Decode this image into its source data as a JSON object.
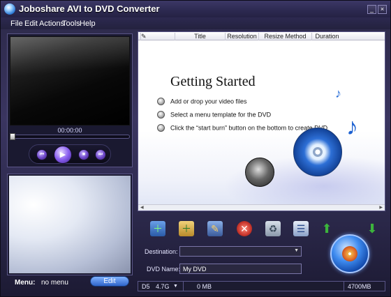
{
  "window": {
    "title": "Joboshare AVI to DVD Converter",
    "minimize_glyph": "_",
    "close_glyph": "×"
  },
  "menubar": {
    "items": [
      "File",
      "Edit",
      "Actions",
      "Tools",
      "Help"
    ]
  },
  "preview": {
    "time": "00:00:00",
    "seek_position": 0,
    "controls": {
      "prev": "⏮",
      "play": "▶",
      "stop": "■",
      "next": "⏭"
    }
  },
  "menu_panel": {
    "label": "Menu:",
    "value": "no menu",
    "edit_label": "Edit"
  },
  "file_list": {
    "columns": [
      "Title",
      "Resolution",
      "Resize Method",
      "Duration"
    ],
    "getting_started": {
      "title": "Getting Started",
      "steps": [
        "Add or drop your video files",
        "Select a menu template for the DVD",
        "Click the “start burn” button on the bottom to create DVD"
      ]
    }
  },
  "toolbar": {
    "icons": [
      "add-video-icon",
      "add-folder-icon",
      "edit-video-icon",
      "remove-icon",
      "clear-trash-icon",
      "properties-icon",
      "move-up-icon",
      "move-down-icon"
    ],
    "colors": {
      "remove": "#c8352c",
      "arrows": "#3cb43c"
    }
  },
  "output": {
    "destination_label": "Destination:",
    "destination_value": "",
    "dvd_name_label": "DVD Name:",
    "dvd_name_value": "My DVD"
  },
  "statusbar": {
    "disc_type": "D5",
    "disc_size": "4.7G",
    "used": "0 MB",
    "capacity": "4700MB"
  }
}
